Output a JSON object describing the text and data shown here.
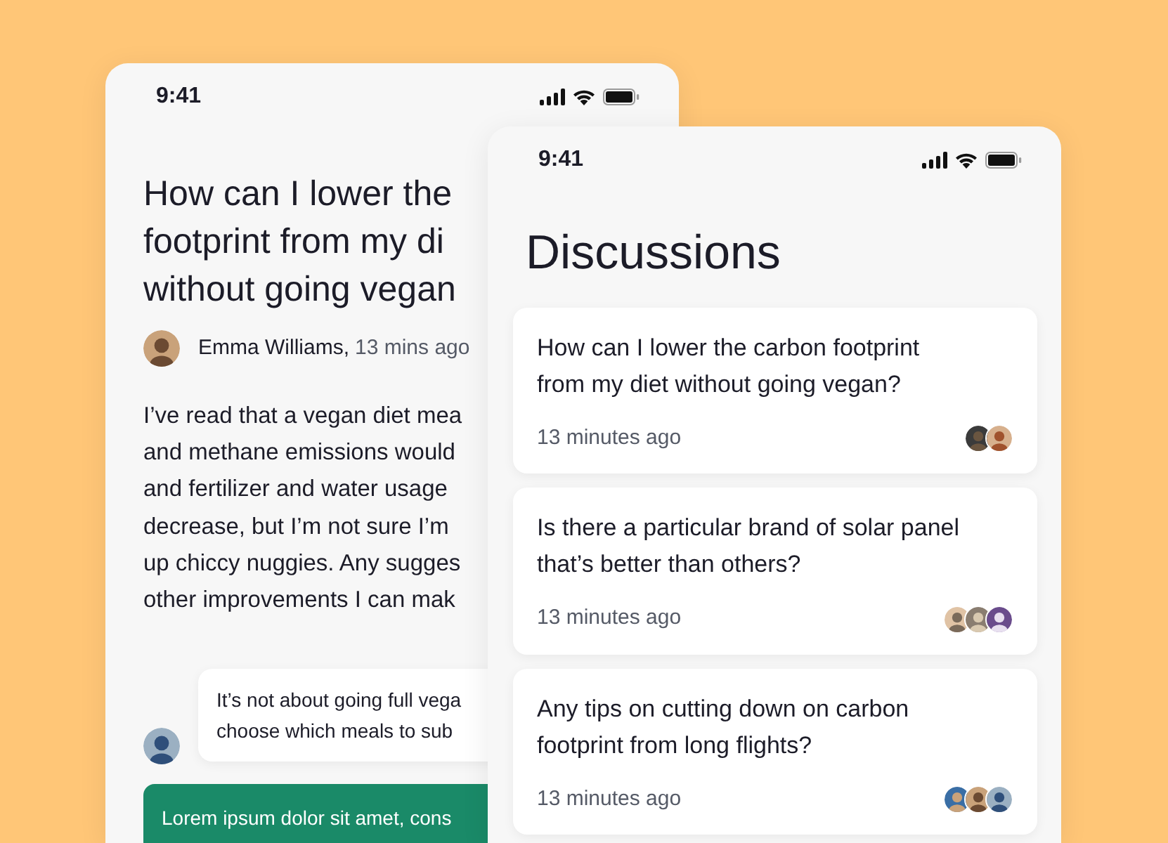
{
  "screens": [
    {
      "kind": "detail",
      "time": "9:41",
      "title_lines": [
        "How can I lower the",
        "footprint from my di",
        "without going vegan"
      ],
      "author": "Emma Williams,",
      "posted": "13 mins ago",
      "body_lines": [
        "I’ve read that a vegan diet mea",
        "and methane emissions would",
        "and fertilizer and water usage",
        "decrease, but I’m not sure I’m",
        "up chiccy nuggies. Any sugges",
        "other improvements I can mak"
      ],
      "comment_lines": [
        "It’s not about going full vega",
        "choose which meals to sub"
      ],
      "reply_lines": [
        "Lorem ipsum dolor sit amet, cons"
      ]
    },
    {
      "kind": "list",
      "time": "9:41",
      "heading": "Discussions",
      "discussions": [
        {
          "title": "How can I lower the carbon footprint from my diet without going vegan?",
          "time": "13 minutes ago"
        },
        {
          "title": "Is there a particular brand of solar panel that’s better than others?",
          "time": "13 minutes ago"
        },
        {
          "title": "Any tips on cutting down on carbon footprint from long flights?",
          "time": "13 minutes ago"
        }
      ]
    }
  ]
}
